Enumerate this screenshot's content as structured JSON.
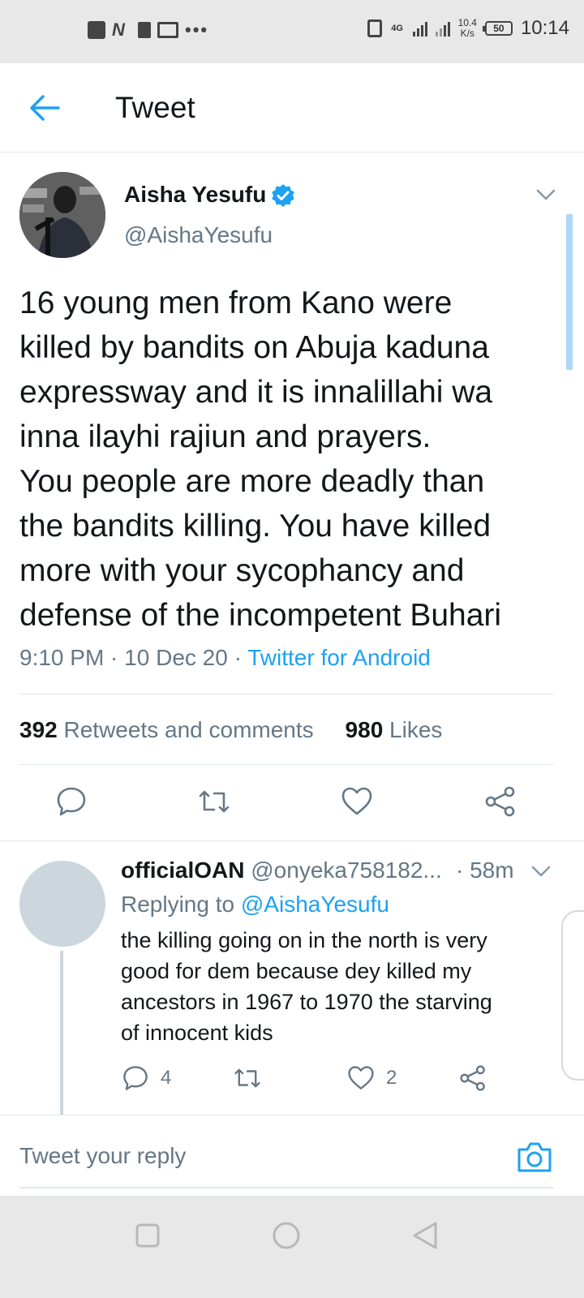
{
  "status_bar": {
    "network": "4G",
    "speed_value": "10.4",
    "speed_unit": "K/s",
    "battery": "50",
    "time": "10:14"
  },
  "header": {
    "title": "Tweet"
  },
  "tweet": {
    "author_name": "Aisha Yesufu",
    "author_handle": "@AishaYesufu",
    "text_lines": [
      "16 young men from Kano were",
      "killed by bandits on Abuja kaduna",
      "expressway and it is innalillahi wa",
      "inna ilayhi rajiun and prayers.",
      "You people are more deadly than",
      "the bandits killing. You have killed",
      "more with your sycophancy and",
      "defense of the incompetent Buhari"
    ],
    "time": "9:10 PM",
    "date": "10 Dec 20",
    "source": "Twitter for Android",
    "retweets_count": "392",
    "retweets_label": "Retweets and comments",
    "likes_count": "980",
    "likes_label": "Likes"
  },
  "reply": {
    "author_name": "officialOAN",
    "author_handle": "@onyeka758182...",
    "time": "· 58m",
    "replying_prefix": "Replying to",
    "replying_to": "@AishaYesufu",
    "text_lines": [
      "the killing going on in the north is very",
      "good for dem because dey killed my",
      "ancestors in 1967 to 1970 the starving",
      "of innocent kids"
    ],
    "comments_count": "4",
    "likes_count": "2"
  },
  "composer": {
    "placeholder": "Tweet your reply"
  },
  "colors": {
    "accent": "#1da1f2",
    "secondary_text": "#657786",
    "divider": "#e1e8ed"
  }
}
